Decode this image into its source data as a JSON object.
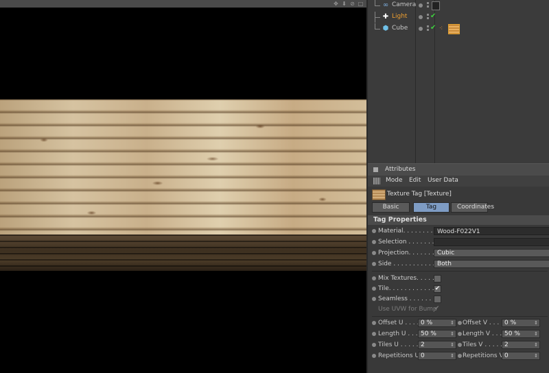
{
  "viewport": {
    "header_icons": [
      "move-icon",
      "down-arrow-icon",
      "search-icon",
      "square-icon"
    ]
  },
  "object_manager": {
    "objects": [
      {
        "name": "Camera",
        "icon": "camera-icon",
        "color": "#c8c8c8"
      },
      {
        "name": "Light",
        "icon": "light-icon",
        "color": "#f0a030"
      },
      {
        "name": "Cube",
        "icon": "cube-icon",
        "color": "#c8c8c8"
      }
    ]
  },
  "attributes": {
    "title": "Attributes",
    "menu": [
      "Mode",
      "Edit",
      "User Data"
    ],
    "object_title": "Texture Tag [Texture]",
    "tabs": [
      "Basic",
      "Tag",
      "Coordinates"
    ],
    "active_tab": "Tag",
    "section_title": "Tag Properties",
    "material_label": "Material. . . . . . . . .",
    "material_value": "Wood-F022V1",
    "selection_label": "Selection . . . . . . . .",
    "selection_value": "",
    "projection_label": "Projection. . . . . . . .",
    "projection_value": "Cubic",
    "side_label": "Side . . . . . . . . . . . .",
    "side_value": "Both",
    "mix_textures_label": "Mix Textures. . . . . .",
    "mix_textures_checked": false,
    "tile_label": "Tile. . . . . . . . . . . . .",
    "tile_checked": true,
    "seamless_label": "Seamless . . . . . . .",
    "seamless_checked": false,
    "uvw_bump_label": "Use UVW for Bump",
    "uvw_bump_checked": true,
    "offset_u_label": "Offset U . . . .",
    "offset_u_value": "0 %",
    "offset_v_label": "Offset V . . . .",
    "offset_v_value": "0 %",
    "length_u_label": "Length U . . . .",
    "length_u_value": "50 %",
    "length_v_label": "Length V . . . .",
    "length_v_value": "50 %",
    "tiles_u_label": "Tiles U . . . . .",
    "tiles_u_value": "2",
    "tiles_v_label": "Tiles V . . . . .",
    "tiles_v_value": "2",
    "rep_u_label": "Repetitions U",
    "rep_u_value": "0",
    "rep_v_label": "Repetitions V",
    "rep_v_value": "0"
  },
  "colors": {
    "active_tab": "#7e9cc4",
    "light_name": "#f0a030",
    "check": "#3fcf3f"
  }
}
